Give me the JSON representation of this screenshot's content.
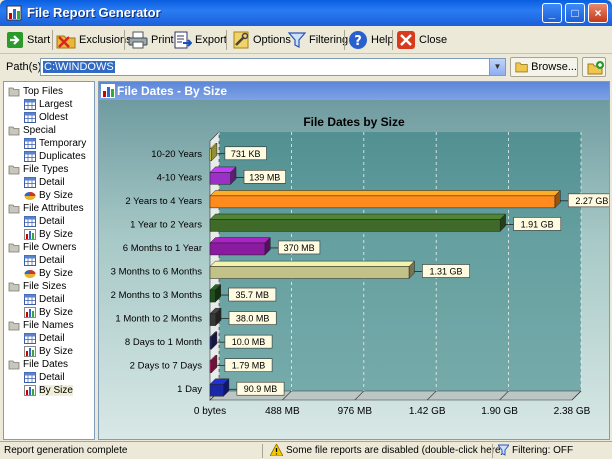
{
  "window": {
    "title": "File Report Generator"
  },
  "toolbar": {
    "start": "Start",
    "exclusions": "Exclusions",
    "print": "Print",
    "export": "Export",
    "options": "Options",
    "filtering": "Filtering",
    "help": "Help",
    "close": "Close"
  },
  "path": {
    "label": "Path(s)",
    "value": "C:\\WINDOWS",
    "browse": "Browse..."
  },
  "tree": {
    "groups": [
      {
        "label": "Top Files",
        "children": [
          "Largest",
          "Oldest"
        ]
      },
      {
        "label": "Special",
        "children": [
          "Temporary",
          "Duplicates"
        ]
      },
      {
        "label": "File Types",
        "children": [
          "Detail",
          "By Size"
        ]
      },
      {
        "label": "File Attributes",
        "children": [
          "Detail",
          "By Size"
        ]
      },
      {
        "label": "File Owners",
        "children": [
          "Detail",
          "By Size"
        ]
      },
      {
        "label": "File Sizes",
        "children": [
          "Detail",
          "By Size"
        ]
      },
      {
        "label": "File Names",
        "children": [
          "Detail",
          "By Size"
        ]
      },
      {
        "label": "File Dates",
        "children": [
          "Detail",
          "By Size"
        ]
      }
    ],
    "selected": "File Dates / By Size"
  },
  "panel": {
    "title": "File Dates - By Size"
  },
  "chart_data": {
    "type": "bar",
    "orientation": "horizontal",
    "title": "File Dates by Size",
    "categories": [
      "10-20 Years",
      "4-10 Years",
      "2 Years to 4 Years",
      "1 Year to 2 Years",
      "6 Months to 1 Year",
      "3 Months to 6 Months",
      "2 Months to 3 Months",
      "1 Month to 2 Months",
      "8 Days to 1 Month",
      "2 Days to 7 Days",
      "1 Day"
    ],
    "values_mb": [
      0.714,
      139,
      2324.5,
      1955.8,
      370,
      1341.4,
      35.7,
      38.0,
      10.0,
      1.79,
      90.9
    ],
    "data_labels": [
      "731 KB",
      "139 MB",
      "2.27 GB",
      "1.91 GB",
      "370 MB",
      "1.31 GB",
      "35.7 MB",
      "38.0 MB",
      "10.0 MB",
      "1.79 MB",
      "90.9 MB"
    ],
    "colors": [
      "#f4ef5a",
      "#9b2fc7",
      "#ff8a1d",
      "#3f6a2a",
      "#8a1aa0",
      "#c2c288",
      "#1e4f1c",
      "#383838",
      "#24246e",
      "#b42060",
      "#1a28a8"
    ],
    "x_ticks": [
      "0 bytes",
      "488 MB",
      "976 MB",
      "1.42 GB",
      "1.90 GB",
      "2.38 GB"
    ],
    "xlim_mb": [
      0,
      2440
    ],
    "grid": true
  },
  "status": {
    "left": "Report generation complete",
    "middle": "Some file reports are disabled (double-click here)",
    "right": "Filtering: OFF"
  },
  "colors": {
    "titlebar": "#1b5fd8",
    "panel_header": "#6a92de",
    "chart_bg": "#8fb5b6"
  }
}
